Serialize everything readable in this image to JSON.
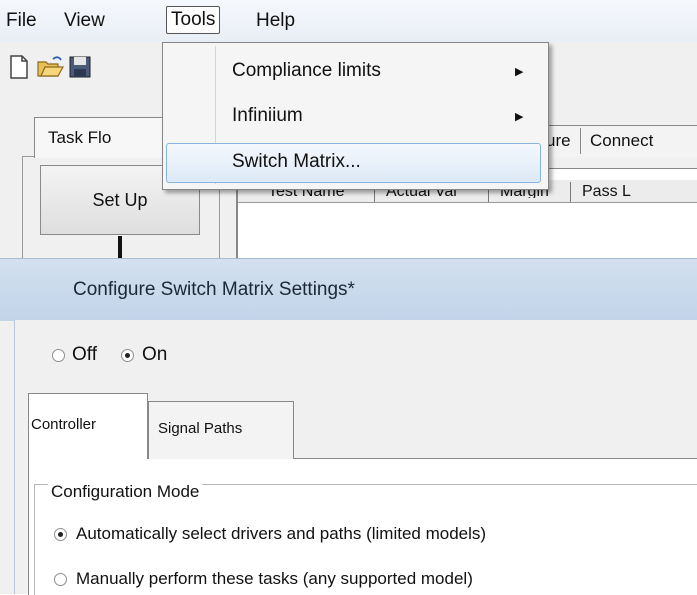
{
  "menubar": {
    "items": [
      "File",
      "View",
      "Tools",
      "Help"
    ]
  },
  "toolbar": {
    "icons": [
      "new-file-icon",
      "open-folder-icon",
      "save-icon"
    ]
  },
  "tools_menu": {
    "items": [
      {
        "label": "Compliance limits",
        "submenu": true
      },
      {
        "label": "Infiniium",
        "submenu": true
      },
      {
        "label": "Switch Matrix...",
        "submenu": false,
        "highlighted": true
      }
    ]
  },
  "task_flow": {
    "tab_label": "Task Flo",
    "setup_button": "Set Up"
  },
  "main_tabs": {
    "partial_tab": "ure",
    "connect_tab": "Connect"
  },
  "results_table": {
    "columns": [
      "Test Name",
      "Actual Val",
      "Margin",
      "Pass L"
    ]
  },
  "dialog": {
    "title": "Configure Switch Matrix Settings*",
    "power": {
      "options": [
        "Off",
        "On"
      ],
      "selected": "On"
    },
    "tabs": [
      "Controller",
      "Signal Paths"
    ],
    "active_tab": "Controller",
    "configuration_mode": {
      "legend": "Configuration Mode",
      "options": [
        "Automatically select drivers and paths (limited models)",
        "Manually perform these tasks (any supported model)"
      ],
      "selected_index": 0
    }
  },
  "colors": {
    "dialog_titlebar": "#c8d8ec",
    "menu_highlight_border": "#8ab4e0",
    "window_bg": "#f0f0f0"
  }
}
